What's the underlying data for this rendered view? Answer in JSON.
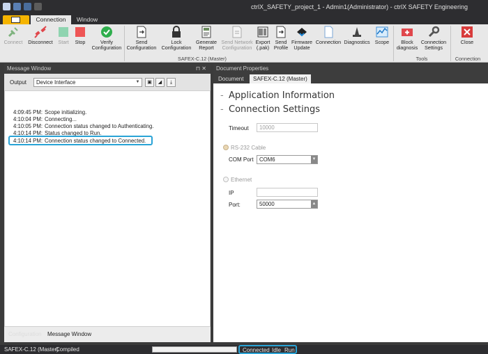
{
  "window": {
    "title": "ctrlX_SAFETY_project_1 - Admin1(Administrator) - ctrlX SAFETY Engineering"
  },
  "tabs": {
    "connection": "Connection",
    "window": "Window"
  },
  "ribbon": {
    "connect": "Connect",
    "disconnect": "Disconnect",
    "start": "Start",
    "stop": "Stop",
    "verify": "Verify\nConfiguration",
    "send_config": "Send\nConfiguration",
    "lock_config": "Lock\nConfiguration",
    "generate_report": "Generate\nReport",
    "send_network": "Send Network\nConfiguration",
    "export_pak": "Export\n(.pak)",
    "send_profile": "Send\nProfile",
    "firmware_update": "Firmware\nUpdate",
    "connection": "Connection",
    "diagnostics": "Diagnostics",
    "scope": "Scope",
    "block_diagnosis": "Block\ndiagnosis",
    "connection_settings": "Connection\nSettings",
    "close": "Close",
    "group_master": "SAFEX-C.12 (Master)",
    "group_tools": "Tools",
    "group_connection": "Connection"
  },
  "message_window": {
    "title": "Message Window",
    "output_label": "Output",
    "output_value": "Device Interface",
    "log": [
      {
        "time": "4:09:45 PM:",
        "text": "Scope initializing."
      },
      {
        "time": "4:10:04 PM:",
        "text": "Connecting..."
      },
      {
        "time": "4:10:05 PM:",
        "text": "Connection status changed to Authenticating."
      },
      {
        "time": "4:10:14 PM:",
        "text": "Status changed to Run."
      },
      {
        "time": "4:10:14 PM:",
        "text": "Connection status changed to Connected."
      }
    ],
    "tab_configuration": "Configuration",
    "tab_message": "Message Window"
  },
  "document_properties": {
    "title": "Document Properties",
    "tab_document": "Document",
    "tab_device": "SAFEX-C.12 (Master)",
    "section_app": "Application Information",
    "section_conn": "Connection Settings",
    "timeout_label": "Timeout",
    "timeout_value": "10000",
    "rs232_label": "RS-232 Cable",
    "com_port_label": "COM Port",
    "com_port_value": "COM6",
    "ethernet_label": "Ethernet",
    "ip_label": "IP",
    "ip_value": "",
    "port_label": "Port:",
    "port_value": "50000"
  },
  "status": {
    "device": "SAFEX-C.12 (Master)",
    "compiled": "Compiled",
    "connected": "Connected",
    "idle": "Idle",
    "run": "Run"
  }
}
